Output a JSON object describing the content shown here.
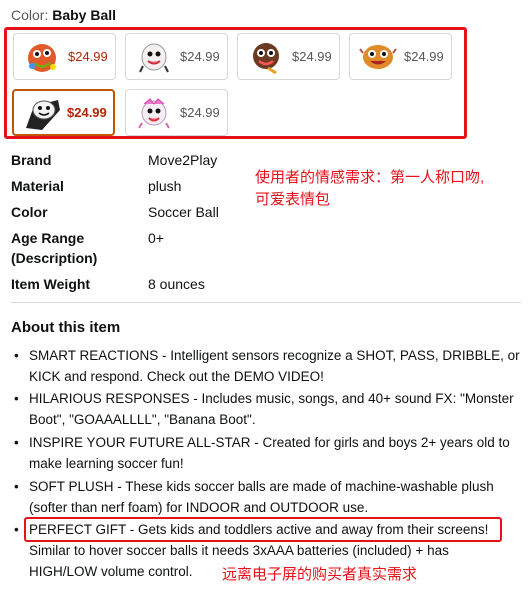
{
  "color_selector": {
    "label": "Color: ",
    "selected": "Baby Ball"
  },
  "swatches": [
    {
      "price": "$24.99",
      "selected": false,
      "icon": "red-ball-face-icon"
    },
    {
      "price": "$24.99",
      "selected": false,
      "icon": "white-ball-face-icon"
    },
    {
      "price": "$24.99",
      "selected": false,
      "icon": "brown-ball-face-icon"
    },
    {
      "price": "$24.99",
      "selected": false,
      "icon": "orange-ball-face-icon"
    },
    {
      "price": "$24.99",
      "selected": true,
      "icon": "black-white-ball-face-icon"
    },
    {
      "price": "$24.99",
      "selected": false,
      "icon": "pink-ball-face-icon"
    }
  ],
  "specs": [
    {
      "key": "Brand",
      "value": "Move2Play"
    },
    {
      "key": "Material",
      "value": "plush"
    },
    {
      "key": "Color",
      "value": "Soccer Ball"
    },
    {
      "key": "Age Range (Description)",
      "key_line1": "Age Range",
      "key_line2": "(Description)",
      "value": "0+"
    },
    {
      "key": "Item Weight",
      "value": "8 ounces"
    }
  ],
  "annotations": {
    "emotional_needs_line1": "使用者的情感需求：第一人称口吻,",
    "emotional_needs_line2": "可爱表情包",
    "screen_away": "远离电子屏的购买者真实需求"
  },
  "about": {
    "title": "About this item",
    "bullets": [
      {
        "line1": "SMART REACTIONS - Intelligent sensors recognize a SHOT, PASS, DRIBBLE, or",
        "line2": "KICK and respond. Check out the DEMO VIDEO!"
      },
      {
        "line1": "HILARIOUS RESPONSES - Includes music, songs, and 40+ sound FX: \"Monster",
        "line2": "Boot\", \"GOAAALLLL\", \"Banana Boot\"."
      },
      {
        "line1": "INSPIRE YOUR FUTURE ALL-STAR - Created for girls and boys 2+ years old to",
        "line2": "make learning soccer fun!"
      },
      {
        "line1": "SOFT PLUSH - These kids soccer balls are made of machine-washable plush",
        "line2": "(softer than nerf foam) for INDOOR and OUTDOOR use."
      },
      {
        "line1": "PERFECT GIFT - Gets kids and toddlers active and away from their screens!",
        "line2": "Similar to hover soccer balls it needs 3xAAA batteries (included) + has",
        "line3": "HIGH/LOW volume control."
      }
    ]
  },
  "colors": {
    "highlight_red": "#e6121a",
    "price_red": "#b12704",
    "selected_border": "#c45500"
  }
}
